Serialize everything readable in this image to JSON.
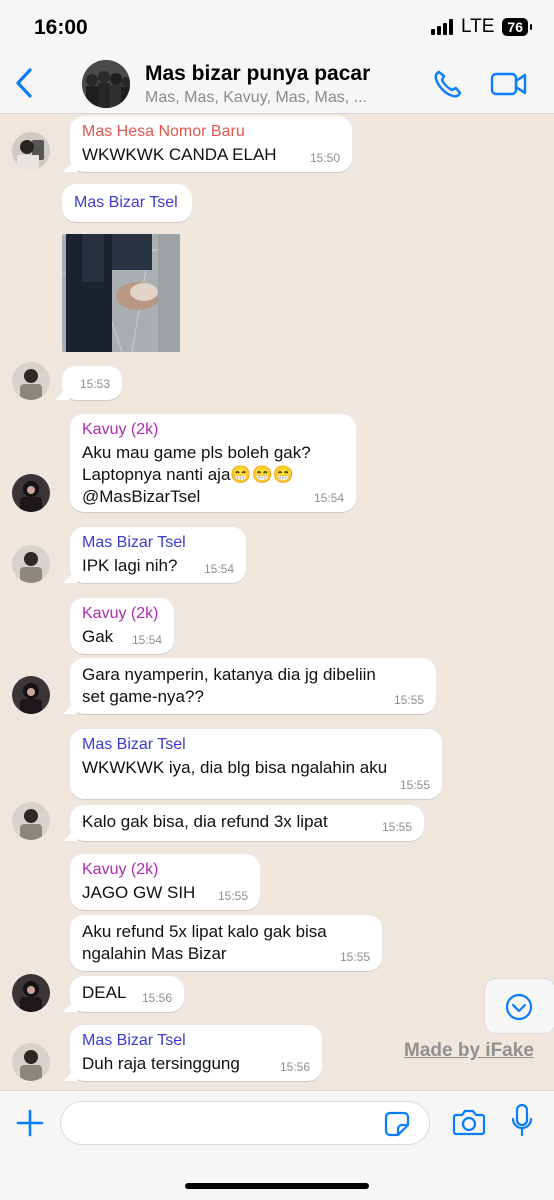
{
  "status": {
    "time": "16:00",
    "network": "LTE",
    "battery": "76"
  },
  "header": {
    "title": "Mas bizar punya pacar",
    "members": "Mas, Mas, Kavuy, Mas, Mas, ...",
    "back_icon": "chevron-left-icon",
    "call_icon": "phone-icon",
    "video_icon": "video-camera-icon"
  },
  "colors": {
    "accent": "#0a7cff",
    "chat_bg": "#efe7dd",
    "sender_hesa": "#e2574c",
    "sender_bizar": "#3b3bd0",
    "sender_kavuy": "#b02cb0",
    "mention": "#1a9f5b"
  },
  "messages": [
    {
      "sender": "Mas Hesa Nomor Baru",
      "text": "WKWKWK CANDA ELAH",
      "time": "15:50"
    },
    {
      "sender": "Mas Bizar Tsel"
    },
    {
      "time": "15:53"
    },
    {
      "sender": "Kavuy (2k)",
      "text": "Aku mau game pls boleh gak? Laptopnya nanti aja😁😁😁",
      "mention": "@MasBizarTsel",
      "time": "15:54"
    },
    {
      "sender": "Mas Bizar Tsel",
      "text": "IPK lagi nih?",
      "time": "15:54"
    },
    {
      "sender": "Kavuy (2k)",
      "text": "Gak",
      "time": "15:54"
    },
    {
      "text_line1": "Gara nyamperin, katanya dia jg dibeliin",
      "text_line2": "set game-nya??",
      "time": "15:55"
    },
    {
      "sender": "Mas Bizar Tsel",
      "text": "WKWKWK iya, dia blg bisa ngalahin aku",
      "time": "15:55"
    },
    {
      "text": "Kalo gak bisa, dia refund 3x lipat",
      "time": "15:55"
    },
    {
      "sender": "Kavuy (2k)",
      "text": "JAGO GW SIH",
      "time": "15:55"
    },
    {
      "text_line1": "Aku refund 5x lipat kalo gak bisa",
      "text_line2": "ngalahin Mas Bizar",
      "time": "15:55"
    },
    {
      "text": "DEAL",
      "time": "15:56"
    },
    {
      "sender": "Mas Bizar Tsel",
      "text": "Duh raja tersinggung",
      "time": "15:56"
    }
  ],
  "watermark": "Made by iFake",
  "input": {
    "placeholder": ""
  }
}
